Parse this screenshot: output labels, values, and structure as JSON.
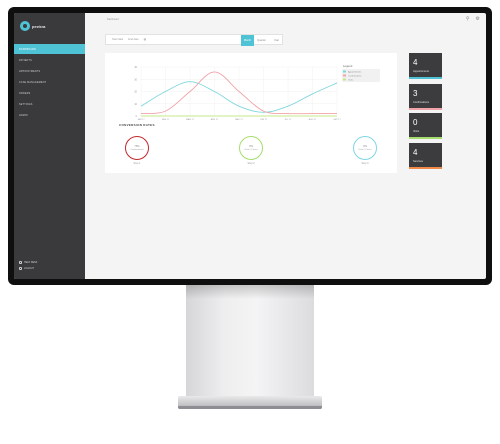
{
  "app": {
    "brand": "peekra"
  },
  "sidebar": {
    "items": [
      {
        "label": "DASHBOARD",
        "active": true
      },
      {
        "label": "PATIENTS",
        "active": false
      },
      {
        "label": "APPOINTMENTS",
        "active": false
      },
      {
        "label": "CASE MANAGEMENT",
        "active": false
      },
      {
        "label": "ORDERS",
        "active": false
      },
      {
        "label": "SETTINGS",
        "active": false
      },
      {
        "label": "ADMIN",
        "active": false
      }
    ],
    "footer": [
      {
        "label": "HELP DESK"
      },
      {
        "label": "LOGOUT"
      }
    ]
  },
  "topbar": {
    "breadcrumb": "Dashboard",
    "icons": [
      "filter-icon",
      "gear-icon"
    ]
  },
  "filter": {
    "start_placeholder": "Start date",
    "end_placeholder": "End date",
    "buttons": [
      "Month",
      "Quarter",
      "Year"
    ]
  },
  "chart_data": {
    "type": "line",
    "x": [
      "JAN 17",
      "FEB 17",
      "MAR 17",
      "APR 17",
      "MAY 17",
      "JUN 17",
      "JUL 17",
      "AUG 17",
      "SEP 17"
    ],
    "yticks": [
      0,
      10,
      20,
      30,
      40
    ],
    "ylim": [
      0,
      40
    ],
    "legend_title": "Legend",
    "series": [
      {
        "name": "Appointments",
        "color": "#7fd6dc",
        "values": [
          8,
          20,
          28,
          20,
          8,
          3,
          8,
          18,
          27
        ]
      },
      {
        "name": "Confirmations",
        "color": "#f0a3a8",
        "values": [
          2,
          4,
          20,
          36,
          20,
          4,
          2,
          2,
          2
        ]
      },
      {
        "name": "Visits",
        "color": "#c7e88a",
        "values": [
          0,
          0,
          0,
          0,
          0,
          0,
          0,
          0,
          0
        ]
      }
    ],
    "grid": true,
    "legend_placement": "top-right"
  },
  "conversion": {
    "title": "CONVERSION RATES",
    "rates": [
      {
        "pct": "75%",
        "label": "Confirmations",
        "caption": "Step 1",
        "color": "#c0282d"
      },
      {
        "pct": "0%",
        "label": "Visits / Cases",
        "caption": "Step 2",
        "color": "#a7dd6e"
      },
      {
        "pct": "0%",
        "label": "Visits / Cases",
        "caption": "Step 3",
        "color": "#7fd6e6"
      }
    ]
  },
  "cards": [
    {
      "value": "4",
      "label": "Appointments",
      "accent": "#4fc3d6"
    },
    {
      "value": "3",
      "label": "Confirmations",
      "accent": "#f0a3a8"
    },
    {
      "value": "0",
      "label": "Visits",
      "accent": "#a7dd6e"
    },
    {
      "value": "4",
      "label": "Services",
      "accent": "#f08a4b"
    }
  ]
}
